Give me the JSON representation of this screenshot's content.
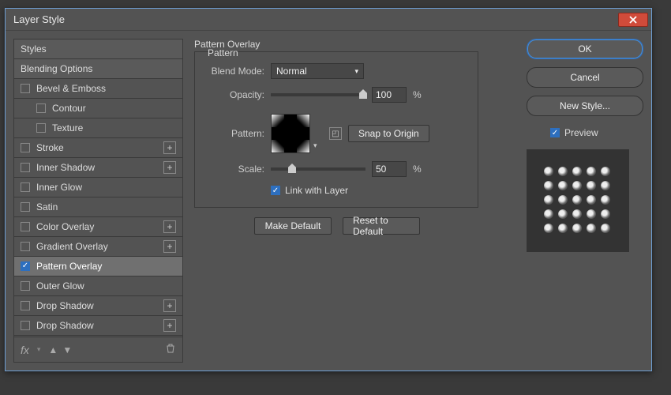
{
  "dialog": {
    "title": "Layer Style"
  },
  "left": {
    "styles": "Styles",
    "blending": "Blending Options",
    "items": [
      {
        "label": "Bevel & Emboss",
        "checked": false,
        "plus": false,
        "indent": false
      },
      {
        "label": "Contour",
        "checked": false,
        "plus": false,
        "indent": true
      },
      {
        "label": "Texture",
        "checked": false,
        "plus": false,
        "indent": true
      },
      {
        "label": "Stroke",
        "checked": false,
        "plus": true,
        "indent": false
      },
      {
        "label": "Inner Shadow",
        "checked": false,
        "plus": true,
        "indent": false
      },
      {
        "label": "Inner Glow",
        "checked": false,
        "plus": false,
        "indent": false
      },
      {
        "label": "Satin",
        "checked": false,
        "plus": false,
        "indent": false
      },
      {
        "label": "Color Overlay",
        "checked": false,
        "plus": true,
        "indent": false
      },
      {
        "label": "Gradient Overlay",
        "checked": false,
        "plus": true,
        "indent": false
      },
      {
        "label": "Pattern Overlay",
        "checked": true,
        "plus": false,
        "indent": false,
        "active": true
      },
      {
        "label": "Outer Glow",
        "checked": false,
        "plus": false,
        "indent": false
      },
      {
        "label": "Drop Shadow",
        "checked": false,
        "plus": true,
        "indent": false
      },
      {
        "label": "Drop Shadow",
        "checked": false,
        "plus": true,
        "indent": false
      }
    ],
    "fx": "fx"
  },
  "panel": {
    "title": "Pattern Overlay",
    "subtitle": "Pattern",
    "blend_mode_label": "Blend Mode:",
    "blend_mode_value": "Normal",
    "opacity_label": "Opacity:",
    "opacity_value": "100",
    "opacity_unit": "%",
    "pattern_label": "Pattern:",
    "snap_label": "Snap to Origin",
    "scale_label": "Scale:",
    "scale_value": "50",
    "scale_unit": "%",
    "link_label": "Link with Layer",
    "make_default": "Make Default",
    "reset_default": "Reset to Default"
  },
  "right": {
    "ok": "OK",
    "cancel": "Cancel",
    "new_style": "New Style...",
    "preview": "Preview"
  }
}
